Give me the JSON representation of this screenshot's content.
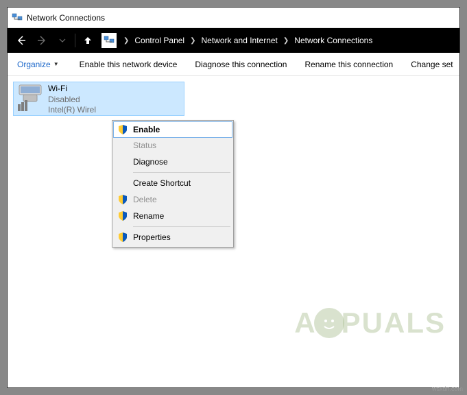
{
  "window": {
    "title": "Network Connections"
  },
  "breadcrumb": {
    "items": [
      "Control Panel",
      "Network and Internet",
      "Network Connections"
    ]
  },
  "toolbar": {
    "organize": "Organize",
    "enable_device": "Enable this network device",
    "diagnose": "Diagnose this connection",
    "rename": "Rename this connection",
    "change": "Change set"
  },
  "adapter": {
    "name": "Wi-Fi",
    "status": "Disabled",
    "device": "Intel(R) Wirel"
  },
  "context_menu": {
    "enable": "Enable",
    "status": "Status",
    "diagnose": "Diagnose",
    "create_shortcut": "Create Shortcut",
    "delete": "Delete",
    "rename": "Rename",
    "properties": "Properties"
  },
  "watermark": {
    "left": "A",
    "right": "PUALS"
  },
  "credit": "wsxdn.com",
  "icons": {
    "shield": "shield",
    "network": "network"
  }
}
